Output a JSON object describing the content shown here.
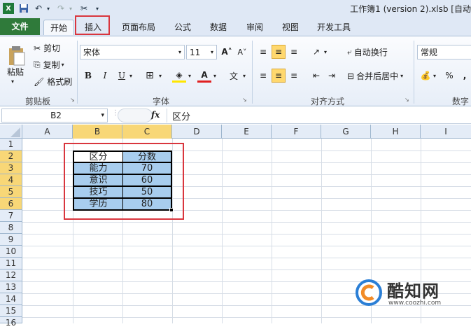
{
  "window": {
    "title": "工作簿1 (version 2).xlsb [自动"
  },
  "tabs": {
    "file": "文件",
    "items": [
      "开始",
      "插入",
      "页面布局",
      "公式",
      "数据",
      "审阅",
      "视图",
      "开发工具"
    ]
  },
  "clipboard": {
    "paste": "粘贴",
    "cut": "剪切",
    "copy": "复制",
    "format_painter": "格式刷",
    "label": "剪贴板"
  },
  "font": {
    "name": "宋体",
    "size": "11",
    "bold": "B",
    "italic": "I",
    "underline": "U",
    "label": "字体"
  },
  "alignment": {
    "wrap": "自动换行",
    "merge": "合并后居中",
    "label": "对齐方式"
  },
  "number": {
    "format": "常规",
    "percent": "%",
    "comma": ",",
    "label": "数字"
  },
  "formula_bar": {
    "name_box": "B2",
    "fx": "fx",
    "value": "区分"
  },
  "columns": [
    "A",
    "B",
    "C",
    "D",
    "E",
    "F",
    "G",
    "H",
    "I"
  ],
  "rows": [
    "1",
    "2",
    "3",
    "4",
    "5",
    "6",
    "7",
    "8",
    "9",
    "10",
    "11",
    "12",
    "13",
    "14",
    "15",
    "16"
  ],
  "table": {
    "header": [
      "区分",
      "分数"
    ],
    "rows": [
      [
        "能力",
        "70"
      ],
      [
        "意识",
        "60"
      ],
      [
        "技巧",
        "50"
      ],
      [
        "学历",
        "80"
      ]
    ]
  },
  "watermark": {
    "brand": "酷知网",
    "url": "www.coozhi.com"
  },
  "colors": {
    "file_tab": "#2f7a3a",
    "highlight": "#d9363e",
    "selection": "#a8cdee",
    "header_selected": "#f8d777"
  }
}
